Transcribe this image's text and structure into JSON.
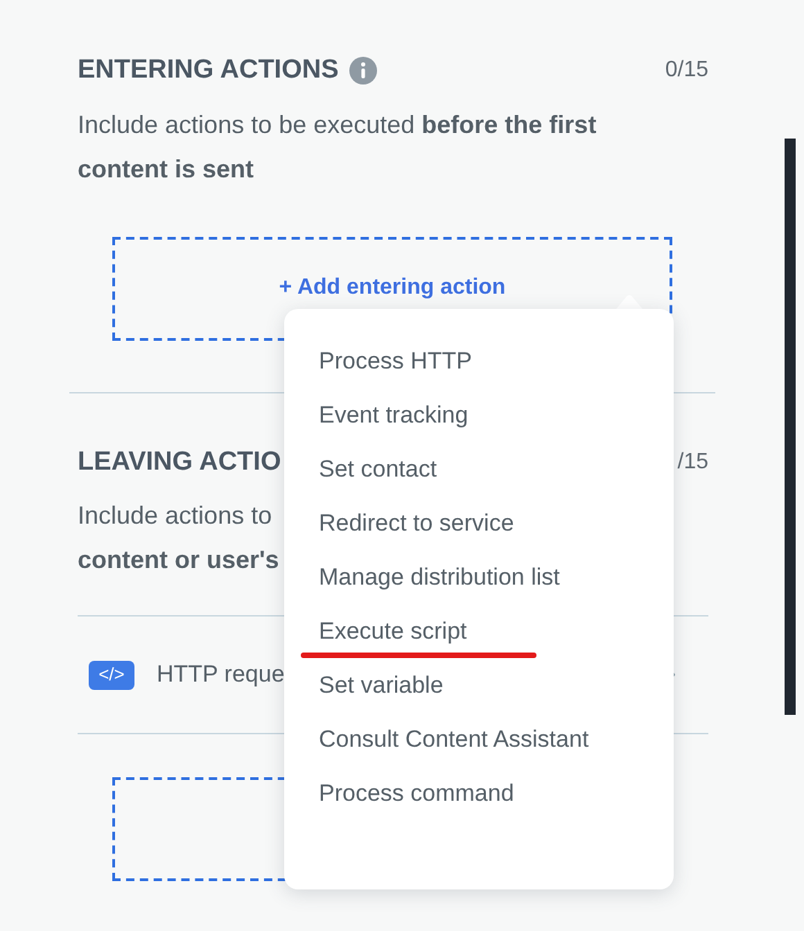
{
  "entering": {
    "title": "ENTERING ACTIONS",
    "count": "0/15",
    "description": [
      {
        "text": "Include actions to be executed **before the first**"
      },
      {
        "text": "**content is sent**"
      }
    ],
    "add_button": "+ Add entering action"
  },
  "leaving": {
    "title": "LEAVING ACTIO",
    "count": "/15",
    "description": [
      {
        "text": "Include actions to"
      },
      {
        "text": "**content or user's**"
      }
    ],
    "actions": [
      {
        "label": "HTTP reque",
        "icon_text": "</>"
      }
    ]
  },
  "menu": {
    "items": [
      {
        "label": "Process HTTP",
        "underlined": false
      },
      {
        "label": "Event tracking",
        "underlined": false
      },
      {
        "label": "Set contact",
        "underlined": false
      },
      {
        "label": "Redirect to service",
        "underlined": false
      },
      {
        "label": "Manage distribution list",
        "underlined": false
      },
      {
        "label": "Execute script",
        "underlined": true
      },
      {
        "label": "Set variable",
        "underlined": false
      },
      {
        "label": "Consult Content Assistant",
        "underlined": false
      },
      {
        "label": "Process command",
        "underlined": false
      }
    ]
  }
}
